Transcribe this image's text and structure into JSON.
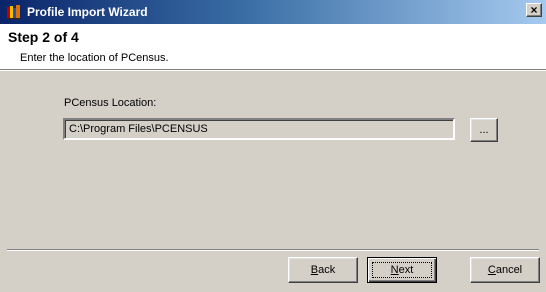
{
  "window": {
    "title": "Profile Import Wizard",
    "close_glyph": "×",
    "icon": "books-icon"
  },
  "header": {
    "step_title": "Step 2 of 4",
    "step_subtitle": "Enter the location of PCensus."
  },
  "form": {
    "location_label": "PCensus Location:",
    "location_value": "C:\\Program Files\\PCENSUS",
    "browse_label": "..."
  },
  "buttons": {
    "back": {
      "accel": "B",
      "rest": "ack"
    },
    "next": {
      "accel": "N",
      "rest": "ext"
    },
    "cancel": {
      "accel": "C",
      "rest": "ancel"
    }
  },
  "colors": {
    "titlebar_start": "#0a246a",
    "titlebar_end": "#a6caf0",
    "face": "#d4d0c8"
  }
}
